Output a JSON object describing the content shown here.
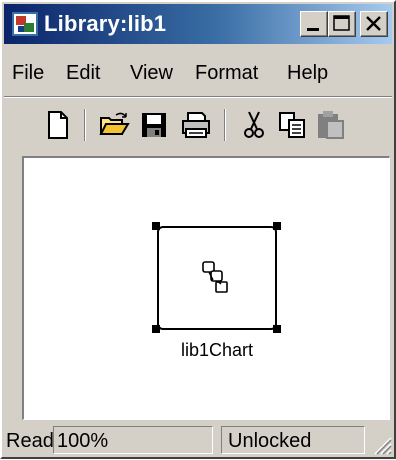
{
  "window": {
    "title": "Library:lib1",
    "controls": {
      "minimize": "minimize-icon",
      "maximize": "maximize-icon",
      "close": "close-icon"
    }
  },
  "menu": {
    "items": [
      "File",
      "Edit",
      "View",
      "Format",
      "Help"
    ]
  },
  "toolbar": {
    "buttons": [
      "new-file-icon",
      "open-folder-icon",
      "save-icon",
      "print-icon",
      "cut-icon",
      "copy-icon",
      "paste-icon"
    ]
  },
  "canvas": {
    "block": {
      "label": "lib1Chart",
      "icon": "stateflow-chart-icon",
      "selected": true
    }
  },
  "status": {
    "mode": "Read",
    "zoom": "100%",
    "lock": "Unlocked"
  },
  "colors": {
    "titlebar_start": "#0a246a",
    "titlebar_end": "#a6caf0",
    "chrome": "#d4d0c8"
  }
}
